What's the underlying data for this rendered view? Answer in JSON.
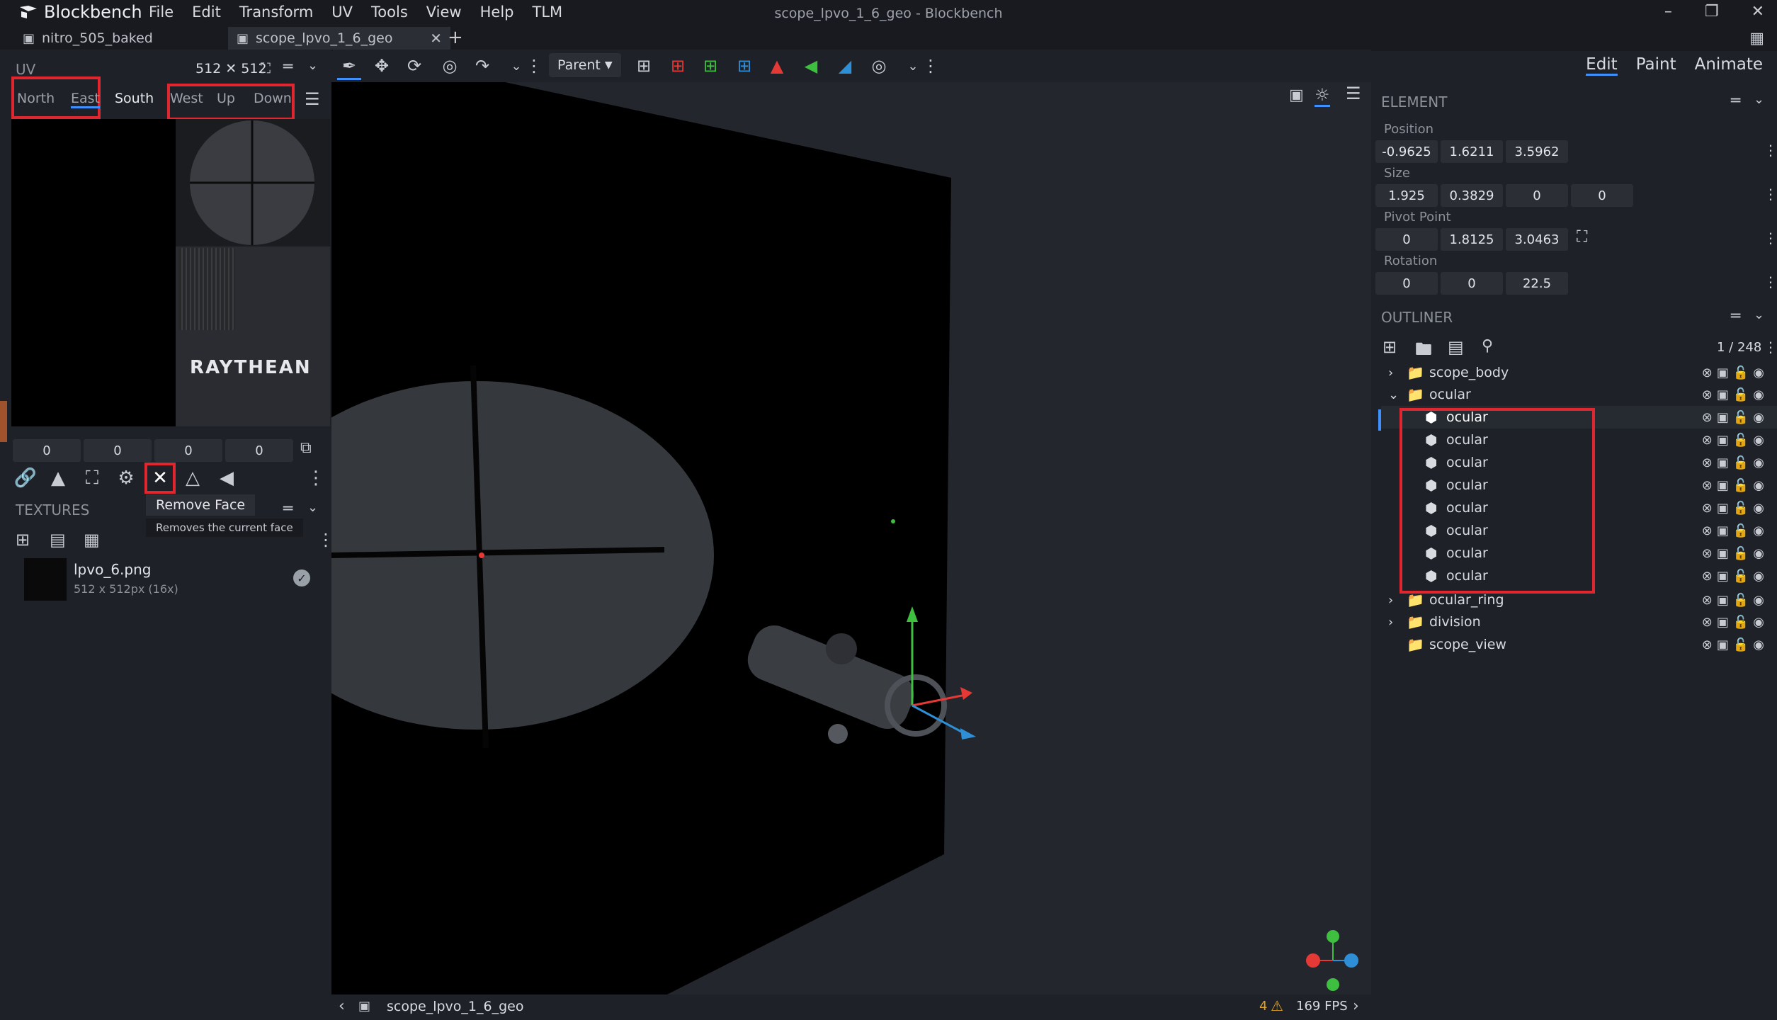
{
  "app": {
    "name": "Blockbench",
    "window_title": "scope_lpvo_1_6_geo - Blockbench"
  },
  "menu": [
    "File",
    "Edit",
    "Transform",
    "UV",
    "Tools",
    "View",
    "Help",
    "TLM"
  ],
  "window_controls": {
    "minimize": "–",
    "restore": "❐",
    "close": "✕"
  },
  "tabs": [
    {
      "label": "nitro_505_baked"
    },
    {
      "label": "scope_lpvo_1_6_geo"
    }
  ],
  "tab_add": "+",
  "toolbar": {
    "parent_label": "Parent"
  },
  "modes": [
    "Edit",
    "Paint",
    "Animate"
  ],
  "uv": {
    "title": "UV",
    "dims": "512 ✕ 512",
    "faces": [
      "North",
      "East",
      "South",
      "West",
      "Up",
      "Down"
    ],
    "values": [
      "0",
      "0",
      "0",
      "0"
    ],
    "texture_text": "RAYTHEAN"
  },
  "tooltip": {
    "title": "Remove Face",
    "desc": "Removes the current face"
  },
  "textures": {
    "title": "TEXTURES",
    "name": "lpvo_6.png",
    "dims": "512 x 512px (16x)"
  },
  "element": {
    "title": "ELEMENT",
    "position_label": "Position",
    "position": [
      "-0.9625",
      "1.6211",
      "3.5962"
    ],
    "size_label": "Size",
    "size": [
      "1.925",
      "0.3829",
      "0",
      "0"
    ],
    "pivot_label": "Pivot Point",
    "pivot": [
      "0",
      "1.8125",
      "3.0463"
    ],
    "rotation_label": "Rotation",
    "rotation": [
      "0",
      "0",
      "22.5"
    ]
  },
  "outliner": {
    "title": "OUTLINER",
    "count": "1 / 248",
    "items": [
      {
        "label": "scope_body"
      },
      {
        "label": "ocular"
      },
      {
        "label": "ocular"
      },
      {
        "label": "ocular"
      },
      {
        "label": "ocular"
      },
      {
        "label": "ocular"
      },
      {
        "label": "ocular"
      },
      {
        "label": "ocular"
      },
      {
        "label": "ocular"
      },
      {
        "label": "ocular"
      },
      {
        "label": "ocular_ring"
      },
      {
        "label": "division"
      },
      {
        "label": "scope_view"
      }
    ]
  },
  "status": {
    "file": "scope_lpvo_1_6_geo",
    "warnings": "4",
    "fps": "169 FPS"
  },
  "colors": {
    "highlight": "#e0262e",
    "accent": "#3e90ff",
    "axis_x": "#e53935",
    "axis_y": "#3fbf3f",
    "axis_z": "#2e8fd6"
  }
}
